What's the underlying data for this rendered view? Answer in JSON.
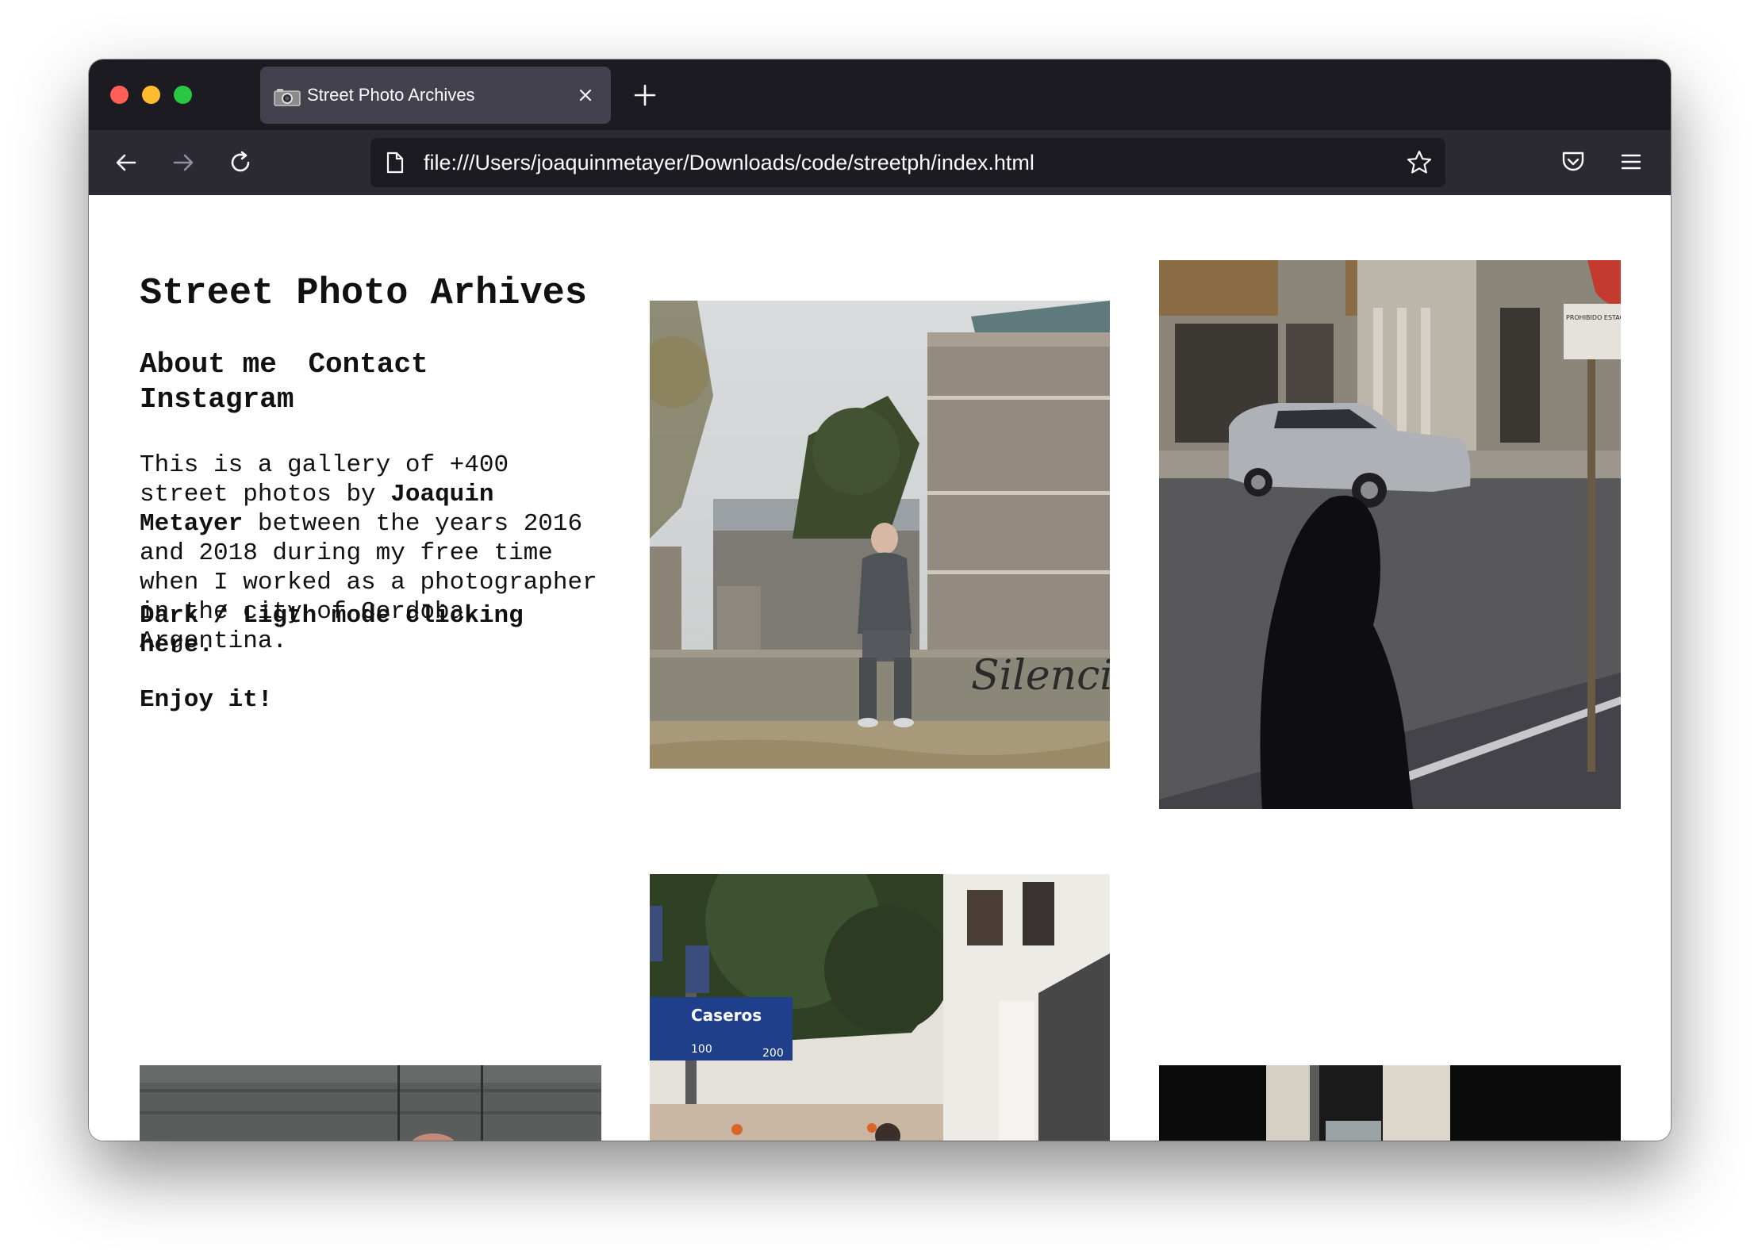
{
  "browser": {
    "tab_title": "Street Photo Archives",
    "url": "file:///Users/joaquinmetayer/Downloads/code/streetph/index.html"
  },
  "page": {
    "title": "Street Photo Arhives",
    "nav": {
      "about": "About me",
      "contact": "Contact",
      "instagram": "Instagram"
    },
    "intro": {
      "part1": "This is a gallery of +400 street photos by ",
      "author": "Joaquin Metayer",
      "part2": " between the years 2016 and 2018 during my free time when I worked as a photographer in the city of Cordoba, Argentina."
    },
    "mode_text": "Dark / Ligth mode clicking ",
    "mode_link": "here",
    "mode_end": ".",
    "enjoy": "Enjoy it!"
  },
  "photo_texts": {
    "graffiti": "Silenci",
    "street_sign": "Caseros",
    "sign_numbers": [
      "100",
      "200"
    ],
    "parking_sign": "PROHIBIDO ESTACION"
  },
  "icons": {
    "tab_favicon": "camera-icon",
    "tab_close": "close-icon",
    "new_tab": "plus-icon",
    "back": "arrow-left-icon",
    "forward": "arrow-right-icon",
    "reload": "reload-icon",
    "page": "page-icon",
    "bookmark": "star-icon",
    "pocket": "pocket-icon",
    "menu": "hamburger-menu-icon"
  },
  "colors": {
    "titlebar": "#1c1b22",
    "toolbar": "#2b2a33",
    "active_tab": "#42414d",
    "close_button": "#ff5f57",
    "minimize_button": "#febc2e",
    "zoom_button": "#28c840"
  }
}
